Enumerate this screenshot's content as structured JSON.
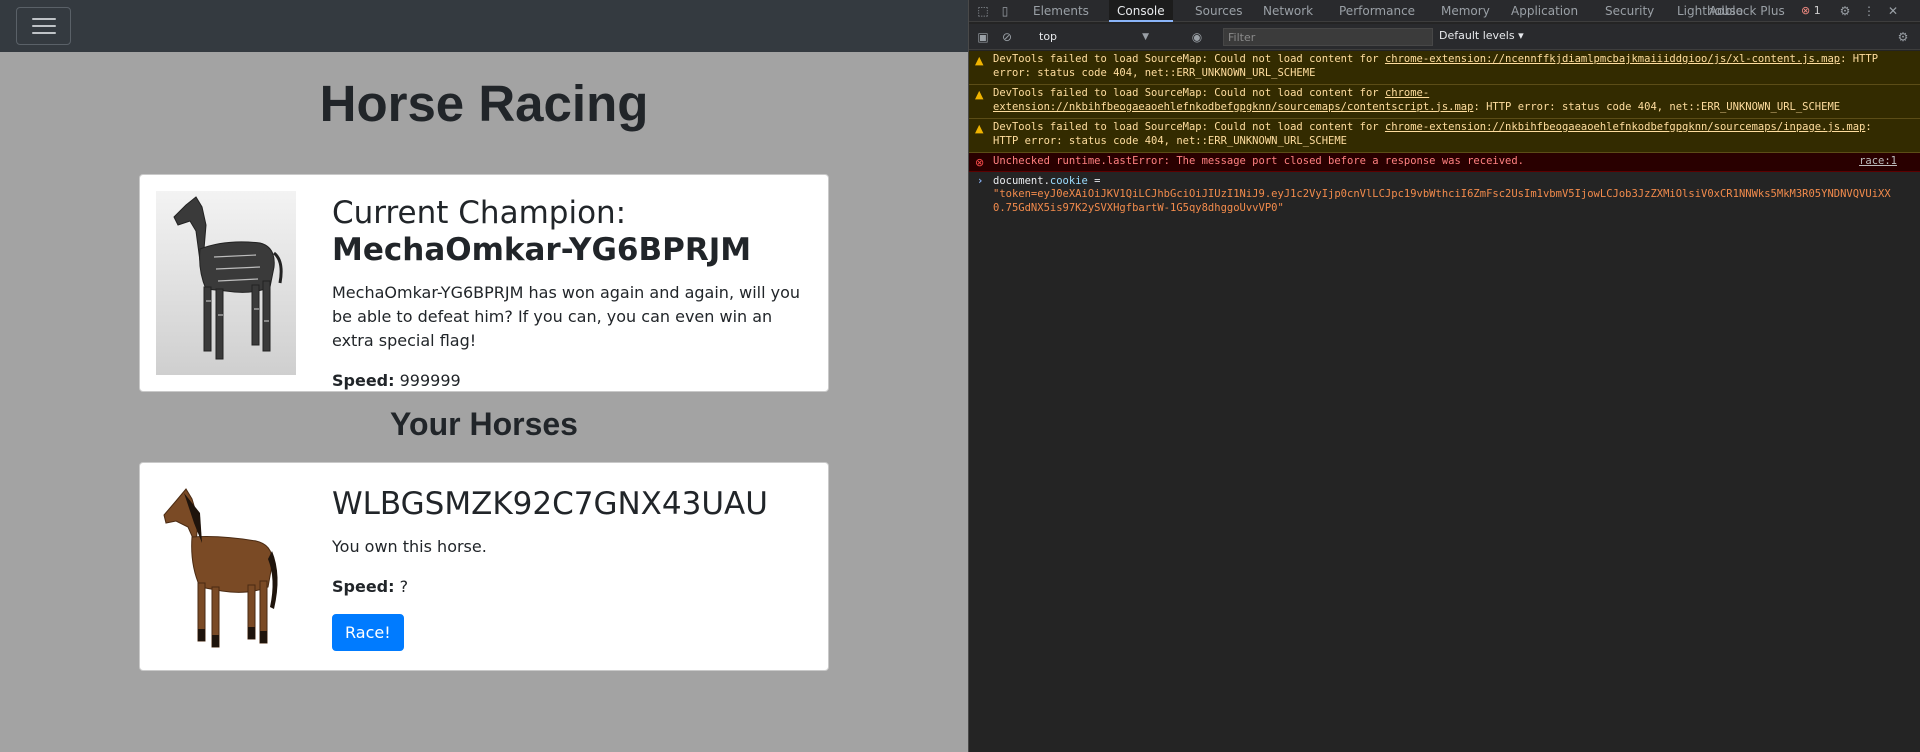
{
  "page": {
    "title": "Horse Racing",
    "section_title": "Your Horses",
    "champion": {
      "heading": "Current Champion:",
      "name": "MechaOmkar-YG6BPRJM",
      "description": "MechaOmkar-YG6BPRJM has won again and again, will you be able to defeat him? If you can, you can even win an extra special flag!",
      "speed_label": "Speed:",
      "speed_value": "999999"
    },
    "horse": {
      "name": "WLBGSMZK92C7GNX43UAU",
      "description": "You own this horse.",
      "speed_label": "Speed:",
      "speed_value": "?",
      "race_label": "Race!"
    }
  },
  "devtools": {
    "tabs": [
      "Elements",
      "Console",
      "Sources",
      "Network",
      "Performance",
      "Memory",
      "Application",
      "Security",
      "Lighthouse",
      "Adblock Plus"
    ],
    "active_tab": "Console",
    "error_count": "1",
    "context": "top",
    "filter_placeholder": "Filter",
    "levels": "Default levels",
    "messages": [
      {
        "type": "warning",
        "prefix": "DevTools failed to load SourceMap: Could not load content for ",
        "link": "chrome-extension://ncennffkjdiamlpmcbajkmaiiiddgioo/js/xl-content.js.map",
        "suffix": ": HTTP error: status code 404, net::ERR_UNKNOWN_URL_SCHEME"
      },
      {
        "type": "warning",
        "prefix": "DevTools failed to load SourceMap: Could not load content for ",
        "link": "chrome-extension://nkbihfbeogaeaoehlefnkodbefgpgknn/sourcemaps/contentscript.js.map",
        "suffix": ": HTTP error: status code 404, net::ERR_UNKNOWN_URL_SCHEME"
      },
      {
        "type": "warning",
        "prefix": "DevTools failed to load SourceMap: Could not load content for ",
        "link": "chrome-extension://nkbihfbeogaeaoehlefnkodbefgpgknn/sourcemaps/inpage.js.map",
        "suffix": ": HTTP error: status code 404, net::ERR_UNKNOWN_URL_SCHEME"
      },
      {
        "type": "error",
        "text": "Unchecked runtime.lastError: The message port closed before a response was received.",
        "source": "race:1"
      }
    ],
    "input": {
      "object": "document",
      "property": "cookie",
      "operator": " =",
      "value": "\"token=eyJ0eXAiOiJKV1QiLCJhbGciOiJIUzI1NiJ9.eyJ1c2VyIjp0cnVlLCJpc19vbWthciI6ZmFsc2UsIm1vbmV5IjowLCJob3JzZXMiOlsiV0xCR1NNWks5MkM3R05YNDNVQVUiXX0.75GdNX5is97K2ySVXHgfbartW-1G5qy8dhggoUvvVP0\""
    }
  }
}
